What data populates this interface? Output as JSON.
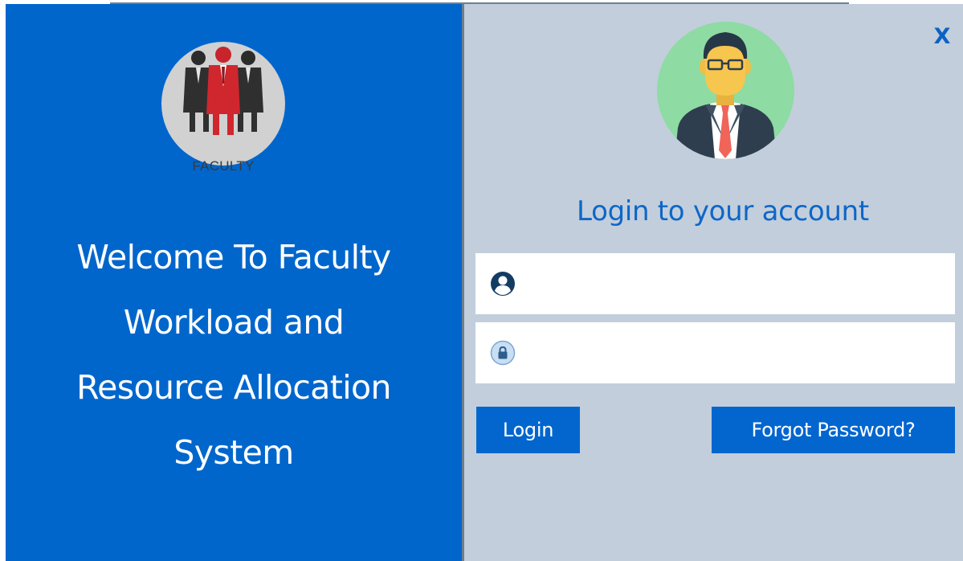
{
  "app": {
    "close_label": "X"
  },
  "left_panel": {
    "logo_caption": "FACULTY",
    "welcome_lines": [
      "Welcome To Faculty",
      "Workload and",
      "Resource Allocation",
      "System"
    ]
  },
  "login": {
    "heading": "Login to your account",
    "username": {
      "value": "",
      "placeholder": "",
      "icon": "user-circle-icon"
    },
    "password": {
      "value": "",
      "placeholder": "",
      "icon": "lock-icon"
    },
    "login_label": "Login",
    "forgot_label": "Forgot Password?"
  },
  "colors": {
    "left_panel_bg": "#0066cc",
    "right_panel_bg": "#c2cedc",
    "accent": "#0366cf",
    "heading_text": "#0d67c7",
    "avatar_bg": "#8edba3",
    "logo_bg": "#d1d1d1"
  }
}
